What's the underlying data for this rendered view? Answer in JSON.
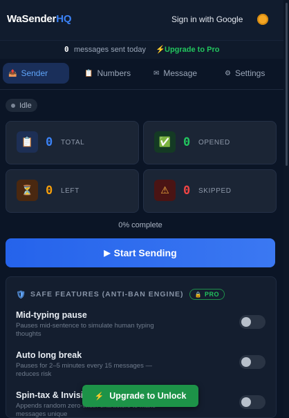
{
  "header": {
    "brand_main": "WaSender",
    "brand_accent": "HQ",
    "signin_label": "Sign in with Google",
    "avatar_icon": "sun-avatar-icon"
  },
  "status_line": {
    "count": "0",
    "label": "messages sent today",
    "upgrade_icon": "⚡",
    "upgrade_label": "Upgrade to Pro"
  },
  "tabs": [
    {
      "label": "Sender",
      "icon": "📤",
      "active": true
    },
    {
      "label": "Numbers",
      "icon": "📋",
      "active": false
    },
    {
      "label": "Message",
      "icon": "✉",
      "active": false
    },
    {
      "label": "Settings",
      "icon": "⚙",
      "active": false
    }
  ],
  "status_badge": {
    "label": "Idle"
  },
  "stats": [
    {
      "label": "TOTAL",
      "value": "0",
      "icon": "📋",
      "color": "#3b82f6"
    },
    {
      "label": "OPENED",
      "value": "0",
      "icon": "✅",
      "color": "#22c55e"
    },
    {
      "label": "LEFT",
      "value": "0",
      "icon": "⏳",
      "color": "#f59e0b"
    },
    {
      "label": "SKIPPED",
      "value": "0",
      "icon": "⚠",
      "color": "#ef4444"
    }
  ],
  "progress": {
    "percent": 0,
    "label": "0% complete"
  },
  "start_button": {
    "icon": "▶",
    "label": "Start Sending"
  },
  "safe_features": {
    "icon": "🛡",
    "title": "SAFE FEATURES (ANTI-BAN ENGINE)",
    "pro_icon": "🔒",
    "pro_label": "PRO",
    "items": [
      {
        "title": "Mid-typing pause",
        "desc": "Pauses mid-sentence to simulate human typing thoughts",
        "enabled": false
      },
      {
        "title": "Auto long break",
        "desc": "Pauses for 2–5 minutes every 15 messages — reduces risk",
        "enabled": false
      },
      {
        "title": "Spin-tax & Invisib",
        "desc": "Appends random zero-width characters to make messages unique",
        "enabled": false
      }
    ]
  },
  "unlock_button": {
    "icon": "⚡",
    "label": "Upgrade to Unlock"
  },
  "colors": {
    "background": "#0b1526",
    "accent_blue": "#3b82f6",
    "accent_green": "#22c55e",
    "accent_orange": "#f59e0b",
    "accent_red": "#ef4444"
  }
}
